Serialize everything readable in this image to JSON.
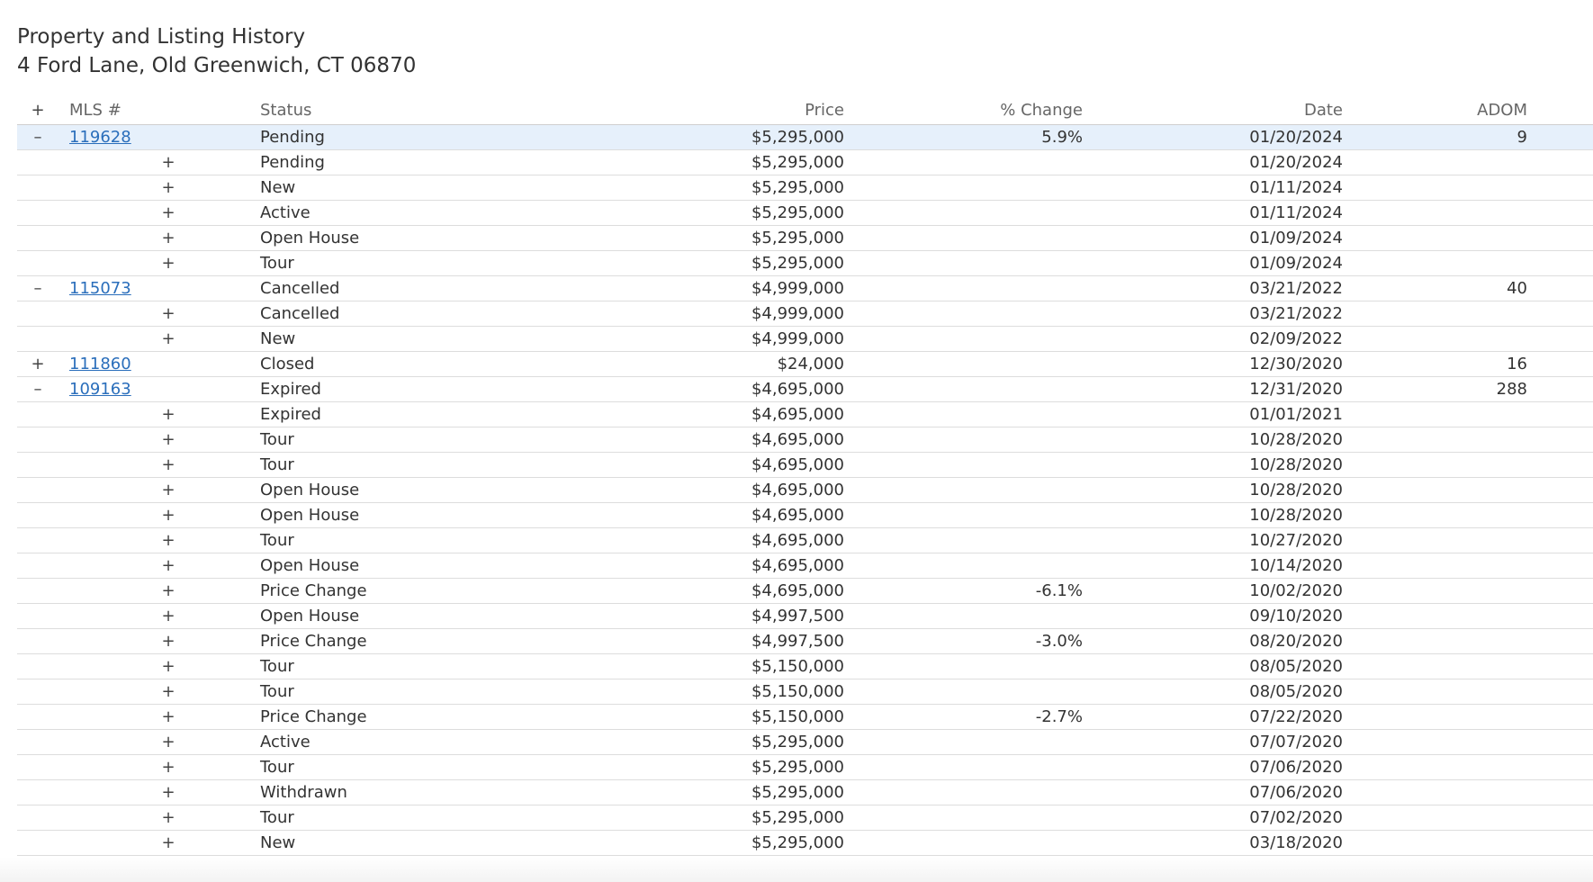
{
  "header": {
    "title": "Property and Listing History",
    "address": "4 Ford Lane, Old Greenwich, CT 06870"
  },
  "columns": {
    "expand": "+",
    "mls": "MLS #",
    "status": "Status",
    "price": "Price",
    "pct_change": "% Change",
    "date": "Date",
    "adom": "ADOM"
  },
  "rows": [
    {
      "level": "parent",
      "toggle": "–",
      "mls": "119628",
      "status": "Pending",
      "price": "$5,295,000",
      "pct": "5.9%",
      "date": "01/20/2024",
      "adom": "9",
      "highlight": true
    },
    {
      "level": "child",
      "toggle": "+",
      "status": "Pending",
      "price": "$5,295,000",
      "pct": "",
      "date": "01/20/2024"
    },
    {
      "level": "child",
      "toggle": "+",
      "status": "New",
      "price": "$5,295,000",
      "pct": "",
      "date": "01/11/2024"
    },
    {
      "level": "child",
      "toggle": "+",
      "status": "Active",
      "price": "$5,295,000",
      "pct": "",
      "date": "01/11/2024"
    },
    {
      "level": "child",
      "toggle": "+",
      "status": "Open House",
      "price": "$5,295,000",
      "pct": "",
      "date": "01/09/2024"
    },
    {
      "level": "child",
      "toggle": "+",
      "status": "Tour",
      "price": "$5,295,000",
      "pct": "",
      "date": "01/09/2024"
    },
    {
      "level": "parent",
      "toggle": "–",
      "mls": "115073",
      "status": "Cancelled",
      "price": "$4,999,000",
      "pct": "",
      "date": "03/21/2022",
      "adom": "40"
    },
    {
      "level": "child",
      "toggle": "+",
      "status": "Cancelled",
      "price": "$4,999,000",
      "pct": "",
      "date": "03/21/2022"
    },
    {
      "level": "child",
      "toggle": "+",
      "status": "New",
      "price": "$4,999,000",
      "pct": "",
      "date": "02/09/2022"
    },
    {
      "level": "parent",
      "toggle": "+",
      "mls": "111860",
      "status": "Closed",
      "price": "$24,000",
      "pct": "",
      "date": "12/30/2020",
      "adom": "16"
    },
    {
      "level": "parent",
      "toggle": "–",
      "mls": "109163",
      "status": "Expired",
      "price": "$4,695,000",
      "pct": "",
      "date": "12/31/2020",
      "adom": "288"
    },
    {
      "level": "child",
      "toggle": "+",
      "status": "Expired",
      "price": "$4,695,000",
      "pct": "",
      "date": "01/01/2021"
    },
    {
      "level": "child",
      "toggle": "+",
      "status": "Tour",
      "price": "$4,695,000",
      "pct": "",
      "date": "10/28/2020"
    },
    {
      "level": "child",
      "toggle": "+",
      "status": "Tour",
      "price": "$4,695,000",
      "pct": "",
      "date": "10/28/2020"
    },
    {
      "level": "child",
      "toggle": "+",
      "status": "Open House",
      "price": "$4,695,000",
      "pct": "",
      "date": "10/28/2020"
    },
    {
      "level": "child",
      "toggle": "+",
      "status": "Open House",
      "price": "$4,695,000",
      "pct": "",
      "date": "10/28/2020"
    },
    {
      "level": "child",
      "toggle": "+",
      "status": "Tour",
      "price": "$4,695,000",
      "pct": "",
      "date": "10/27/2020"
    },
    {
      "level": "child",
      "toggle": "+",
      "status": "Open House",
      "price": "$4,695,000",
      "pct": "",
      "date": "10/14/2020"
    },
    {
      "level": "child",
      "toggle": "+",
      "status": "Price Change",
      "price": "$4,695,000",
      "pct": "-6.1%",
      "date": "10/02/2020"
    },
    {
      "level": "child",
      "toggle": "+",
      "status": "Open House",
      "price": "$4,997,500",
      "pct": "",
      "date": "09/10/2020"
    },
    {
      "level": "child",
      "toggle": "+",
      "status": "Price Change",
      "price": "$4,997,500",
      "pct": "-3.0%",
      "date": "08/20/2020"
    },
    {
      "level": "child",
      "toggle": "+",
      "status": "Tour",
      "price": "$5,150,000",
      "pct": "",
      "date": "08/05/2020"
    },
    {
      "level": "child",
      "toggle": "+",
      "status": "Tour",
      "price": "$5,150,000",
      "pct": "",
      "date": "08/05/2020"
    },
    {
      "level": "child",
      "toggle": "+",
      "status": "Price Change",
      "price": "$5,150,000",
      "pct": "-2.7%",
      "date": "07/22/2020"
    },
    {
      "level": "child",
      "toggle": "+",
      "status": "Active",
      "price": "$5,295,000",
      "pct": "",
      "date": "07/07/2020"
    },
    {
      "level": "child",
      "toggle": "+",
      "status": "Tour",
      "price": "$5,295,000",
      "pct": "",
      "date": "07/06/2020"
    },
    {
      "level": "child",
      "toggle": "+",
      "status": "Withdrawn",
      "price": "$5,295,000",
      "pct": "",
      "date": "07/06/2020"
    },
    {
      "level": "child",
      "toggle": "+",
      "status": "Tour",
      "price": "$5,295,000",
      "pct": "",
      "date": "07/02/2020"
    },
    {
      "level": "child",
      "toggle": "+",
      "status": "New",
      "price": "$5,295,000",
      "pct": "",
      "date": "03/18/2020"
    }
  ],
  "colors": {
    "link": "#2a6ebb",
    "highlight_row": "#e6f0fb",
    "text": "#333333",
    "header_text": "#666666"
  }
}
